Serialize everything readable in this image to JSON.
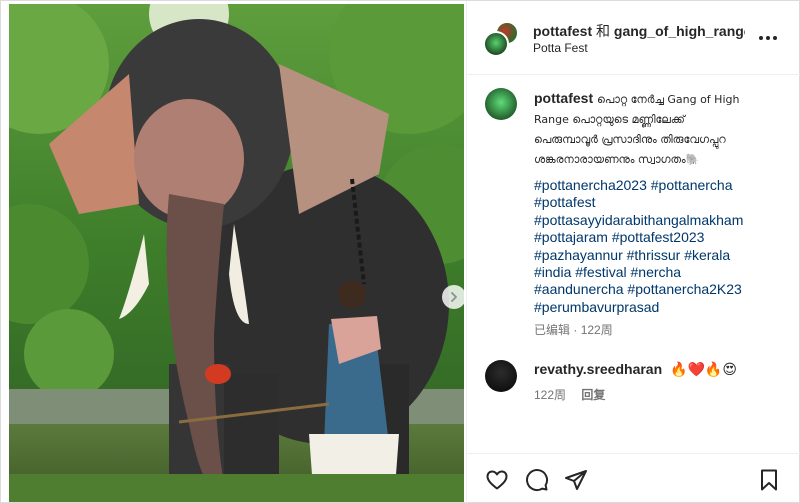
{
  "post": {
    "header": {
      "account": "pottafest",
      "conjunction": "和",
      "collaborator": "gang_of_high_range",
      "location": "Potta Fest",
      "more_icon": "more-horizontal-icon"
    },
    "caption": {
      "user": "pottafest",
      "text_line1": "പൊറ്റ നേർച്ച Gang of High",
      "text_line2": "Range പൊറ്റയുടെ മണ്ണിലേക്ക്",
      "text_line3": "പെരുമ്പാവൂർ പ്രസാദിനും തിരുവേഗപ്പുറ",
      "text_line4": "ശങ്കരനാരായണനും സ്വാഗതം🐘",
      "hashtags": [
        "#pottanercha2023 #pottanercha",
        "#pottafest",
        "#pottasayyidarabithangalmakham",
        "#pottajaram #pottafest2023",
        "#pazhayannur #thrissur #kerala",
        "#india #festival #nercha",
        "#aandunercha #pottanercha2K23",
        "#perumbavurprasad"
      ],
      "edited": "已编辑",
      "age": "122周"
    },
    "comment": {
      "user": "revathy.sreedharan",
      "text": "🔥❤️🔥😍",
      "age": "122周",
      "reply": "回复"
    },
    "actions": {
      "like_icon": "heart-icon",
      "comment_icon": "comment-icon",
      "share_icon": "share-icon",
      "save_icon": "bookmark-icon"
    },
    "carousel": {
      "next_icon": "chevron-right-icon"
    }
  },
  "colors": {
    "text": "#262626",
    "secondary": "#737373",
    "hashtag": "#00376b",
    "border": "#dbdbdb"
  }
}
